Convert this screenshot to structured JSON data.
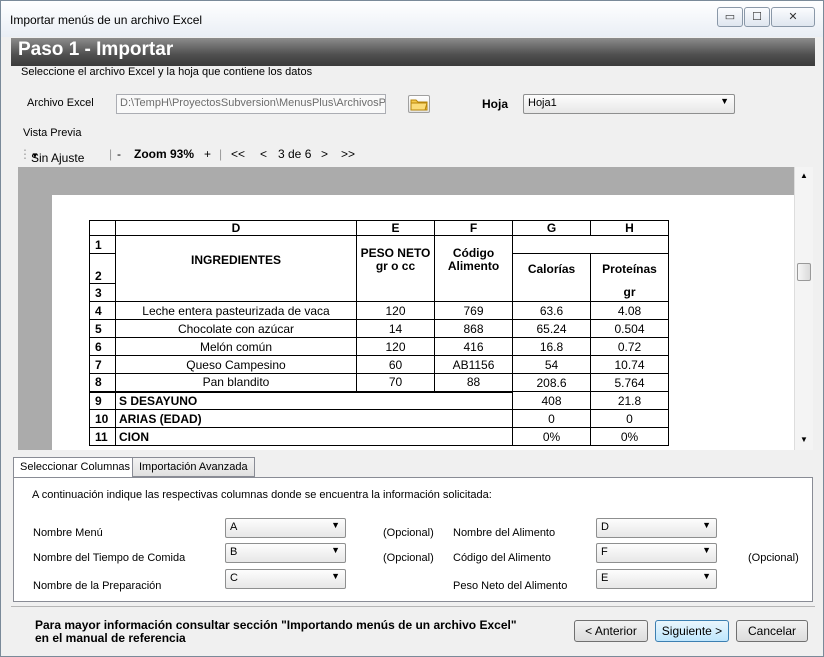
{
  "window": {
    "title": "Importar menús de un archivo Excel",
    "minimize": "▭",
    "maximize": "☐",
    "close": "✕"
  },
  "header": {
    "title": "Paso 1 - Importar",
    "subtitle": "Seleccione el archivo Excel y la hoja que contiene los datos"
  },
  "file": {
    "label": "Archivo Excel",
    "value": "D:\\TempH\\ProyectosSubversion\\MenusPlus\\ArchivosP",
    "sheet_label": "Hoja",
    "sheet_value": "Hoja1"
  },
  "preview": {
    "label": "Vista Previa",
    "fit": "Sin Ajuste",
    "minus": "-",
    "zoom": "Zoom 93%",
    "plus": "+",
    "first": "<<",
    "prev": "<",
    "page": "3 de 6",
    "next": ">",
    "last": ">>"
  },
  "sheet": {
    "col_headers": [
      "D",
      "E",
      "F",
      "G",
      "H"
    ],
    "r1": "1",
    "r2": "2",
    "r3": "3",
    "ingredientes": "INGREDIENTES",
    "peso_neto": "PESO NETO gr o cc",
    "codigo": "Código Alimento",
    "calorias": "Calorías",
    "proteinas": "Proteínas",
    "gr": "gr",
    "rows": [
      {
        "n": "4",
        "d": "Leche entera pasteurizada de vaca",
        "e": "120",
        "f": "769",
        "g": "63.6",
        "h": "4.08"
      },
      {
        "n": "5",
        "d": "Chocolate con azúcar",
        "e": "14",
        "f": "868",
        "g": "65.24",
        "h": "0.504"
      },
      {
        "n": "6",
        "d": "Melón común",
        "e": "120",
        "f": "416",
        "g": "16.8",
        "h": "0.72"
      },
      {
        "n": "7",
        "d": "Queso Campesino",
        "e": "60",
        "f": "AB1156",
        "g": "54",
        "h": "10.74"
      },
      {
        "n": "8",
        "d": "Pan blandito",
        "e": "70",
        "f": "88",
        "g": "208.6",
        "h": "5.764"
      }
    ],
    "r9": "9",
    "r9_text": "S  DESAYUNO",
    "r9_g": "408",
    "r9_h": "21.8",
    "r10": "10",
    "r10_text": "ARIAS   (EDAD)",
    "r10_g": "0",
    "r10_h": "0",
    "r11": "11",
    "r11_text": "CION",
    "r11_g": "0%",
    "r11_h": "0%"
  },
  "tabs": [
    "Seleccionar Columnas",
    "Importación Avanzada"
  ],
  "columns": {
    "intro": "A continuación indique las respectivas columnas donde se encuentra la información solicitada:",
    "nombre_menu": "Nombre Menú",
    "nombre_menu_val": "A",
    "opcional": "(Opcional)",
    "tiempo_comida": "Nombre del Tiempo de Comida",
    "tiempo_comida_val": "B",
    "preparacion": "Nombre de la Preparación",
    "preparacion_val": "C",
    "nombre_alimento": "Nombre del Alimento",
    "nombre_alimento_val": "D",
    "codigo_alimento": "Código del Alimento",
    "codigo_alimento_val": "F",
    "peso_neto": "Peso Neto del Alimento",
    "peso_neto_val": "E"
  },
  "footer": {
    "note_line1": "Para mayor información consultar  sección \"Importando menús de un archivo Excel\"",
    "note_line2": "en el manual de referencia",
    "anterior": "< Anterior",
    "siguiente": "Siguiente >",
    "cancelar": "Cancelar"
  }
}
